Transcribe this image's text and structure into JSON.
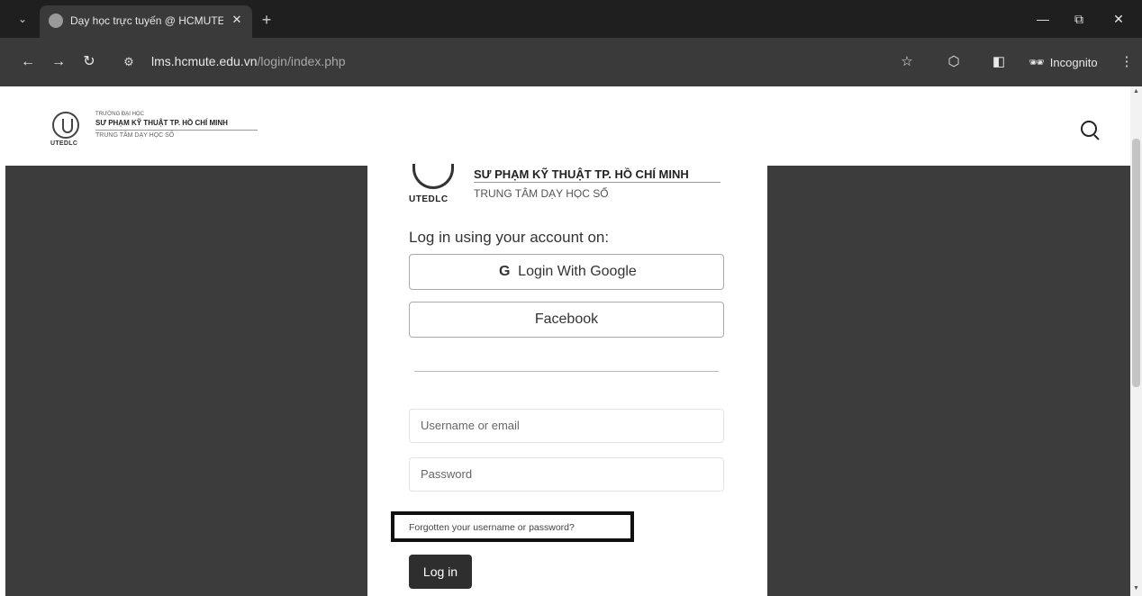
{
  "browser": {
    "tab_title": "Dạy học trực tuyến @ HCMUTE",
    "tab_close": "✕",
    "new_tab": "+",
    "url_host": "lms.hcmute.edu.vn",
    "url_path": "/login/index.php",
    "incognito_label": "Incognito",
    "window_minimize": "—",
    "window_restore": "⧉",
    "window_close": "✕"
  },
  "header": {
    "line1": "TRƯỜNG ĐẠI HỌC",
    "line2": "SƯ PHẠM KỸ THUẬT TP. HỒ CHÍ MINH",
    "line3": "TRUNG TÂM DẠY HỌC SỐ",
    "logo_word": "UTEDLC"
  },
  "login": {
    "brand_word": "UTEDLC",
    "org_name": "SƯ PHẠM KỸ THUẬT TP. HỒ CHÍ MINH",
    "org_sub": "TRUNG TÂM DẠY HỌC SỐ",
    "heading": "Log in using your account on:",
    "google_label": "Login With Google",
    "facebook_label": "Facebook",
    "username_placeholder": "Username or email",
    "password_placeholder": "Password",
    "forgot_link": "Forgotten your username or password?",
    "login_button": "Log in"
  }
}
